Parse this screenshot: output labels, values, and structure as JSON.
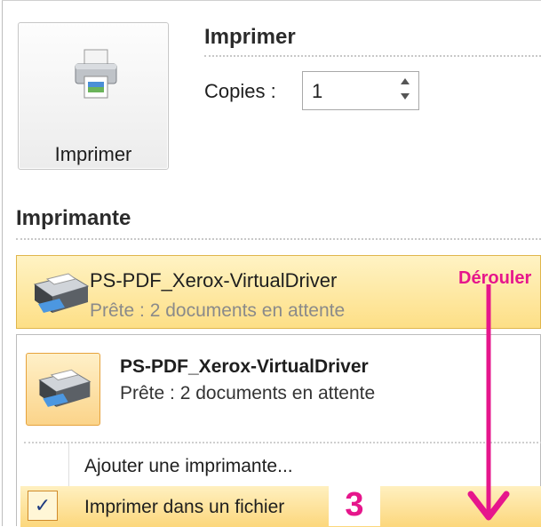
{
  "print": {
    "button_label": "Imprimer",
    "section_title": "Imprimer",
    "copies_label": "Copies :",
    "copies_value": "1"
  },
  "printer": {
    "section_title": "Imprimante",
    "selected": {
      "name": "PS-PDF_Xerox-VirtualDriver",
      "status": "Prête : 2 documents en attente"
    },
    "dropdown": {
      "item": {
        "name": "PS-PDF_Xerox-VirtualDriver",
        "status": "Prête : 2 documents en attente"
      },
      "add_printer": "Ajouter une imprimante...",
      "print_to_file": "Imprimer dans un fichier",
      "print_to_file_checked": true,
      "check_glyph": "✓"
    }
  },
  "annotations": {
    "derouler": "Dérouler",
    "step": "3",
    "color": "#e6168c"
  },
  "colors": {
    "selection_top": "#fff3c4",
    "selection_bottom": "#fddf86",
    "selection_border": "#e0b64c"
  },
  "icons": {
    "printer": "printer-icon",
    "spin": "spin-arrows-icon",
    "check": "checkmark-icon",
    "arrow": "down-arrow-icon"
  }
}
